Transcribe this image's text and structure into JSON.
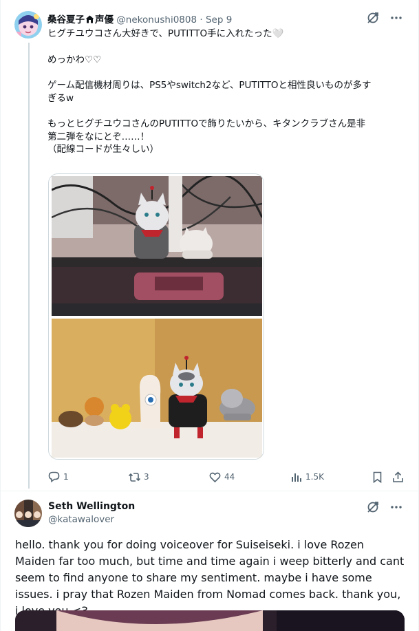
{
  "post": {
    "display_name": "桑谷夏子",
    "name_suffix": "声優",
    "handle": "@nekonushi0808",
    "separator": "·",
    "date": "Sep 9",
    "lines": [
      "ヒグチユウコさん大好きで、PUTITTO手に入れたった🤍",
      "",
      "めっかわ♡♡",
      "",
      "ゲーム配信機材周りは、PS5やswitch2など、PUTITTOと相性良いものが多す",
      "ぎるw",
      "",
      "もっとヒグチユウコさんのPUTITTOで飾りたいから、キタンクラブさん是非",
      "第二弾をなにとぞ……！",
      "（配線コードが生々しい）"
    ],
    "media": [
      {
        "icon": "photo-figures-on-monitor"
      },
      {
        "icon": "photo-figures-on-shelf"
      }
    ],
    "actions": {
      "reply_count": "1",
      "repost_count": "3",
      "like_count": "44",
      "view_count": "1.5K"
    }
  },
  "reply": {
    "display_name": "Seth Wellington",
    "handle": "@katawalover",
    "text": "hello. thank you for doing voiceover for Suiseiseki. i love Rozen Maiden far too much, but time and time again i weep bitterly and cant seem to find anyone to share my sentiment. maybe i have some issues. i pray that Rozen Maiden from Nomad comes back. thank you, i love you <3"
  },
  "icons": {
    "grok": "grok-icon",
    "more": "more-icon",
    "reply": "reply-icon",
    "repost": "repost-icon",
    "like": "like-icon",
    "views": "views-icon",
    "bookmark": "bookmark-icon",
    "share": "share-icon"
  },
  "colors": {
    "text": "#0f1419",
    "muted": "#536471",
    "border": "#eff3f4",
    "thread_line": "#cfd9de"
  }
}
